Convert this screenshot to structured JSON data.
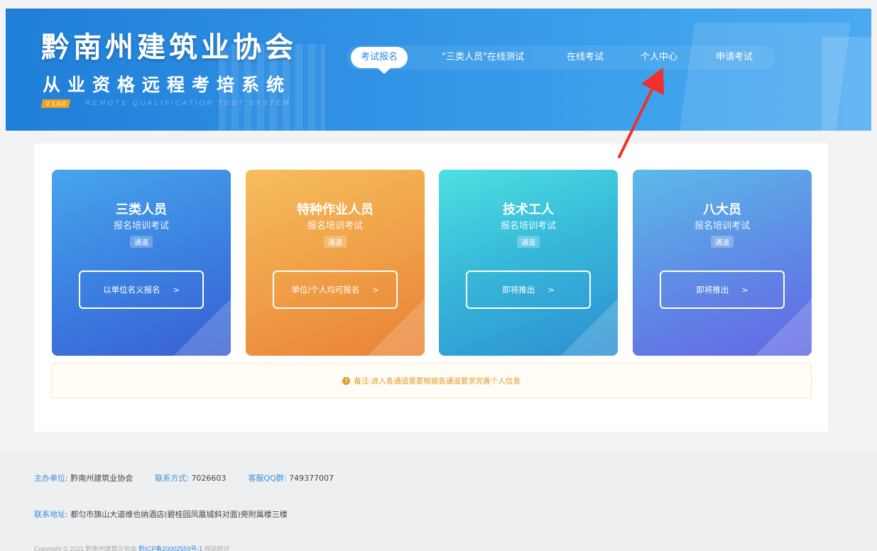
{
  "header": {
    "title": "黔南州建筑业协会",
    "subtitle": "从业资格远程考培系统",
    "version": "V 1.0.0",
    "english_subtitle": "REMOTE QUALIFICATION TEST SYSTEM",
    "nav": [
      {
        "label": "考试报名",
        "active": true
      },
      {
        "label": "\"三类人员\"在线测试",
        "active": false
      },
      {
        "label": "在线考试",
        "active": false
      },
      {
        "label": "个人中心",
        "active": false
      },
      {
        "label": "申请考试",
        "active": false
      }
    ]
  },
  "cards": [
    {
      "title": "三类人员",
      "subtitle": "报名培训考试",
      "tag": "通道",
      "button": "以单位名义报名",
      "arrow": ">"
    },
    {
      "title": "特种作业人员",
      "subtitle": "报名培训考试",
      "tag": "通道",
      "button": "单位/个人均可报名",
      "arrow": ">"
    },
    {
      "title": "技术工人",
      "subtitle": "报名培训考试",
      "tag": "通道",
      "button": "即将推出",
      "arrow": ">"
    },
    {
      "title": "八大员",
      "subtitle": "报名培训考试",
      "tag": "通道",
      "button": "即将推出",
      "arrow": ">"
    }
  ],
  "notice": "备注:进入各通道需要根据各通道要求完善个人信息",
  "footer": {
    "host_label": "主办单位:",
    "host_value": "黔南州建筑业协会",
    "contact_label": "联系方式:",
    "contact_value": "7026603",
    "qq_label": "客服QQ群:",
    "qq_value": "749377007",
    "address_label": "联系地址:",
    "address_value": "都匀市旗山大道维也纳酒店(碧桂园凤凰城斜对面)旁附属楼三楼",
    "copyright": "Copyright © 2021 黔南州建筑业协会",
    "icp": "黔ICP备20002559号-1",
    "stats": "网站统计"
  },
  "colors": {
    "banner": "#2e8fe3",
    "accent": "#3b8fd9",
    "notice": "#e79a2a",
    "annotation_arrow": "#f0302a"
  }
}
